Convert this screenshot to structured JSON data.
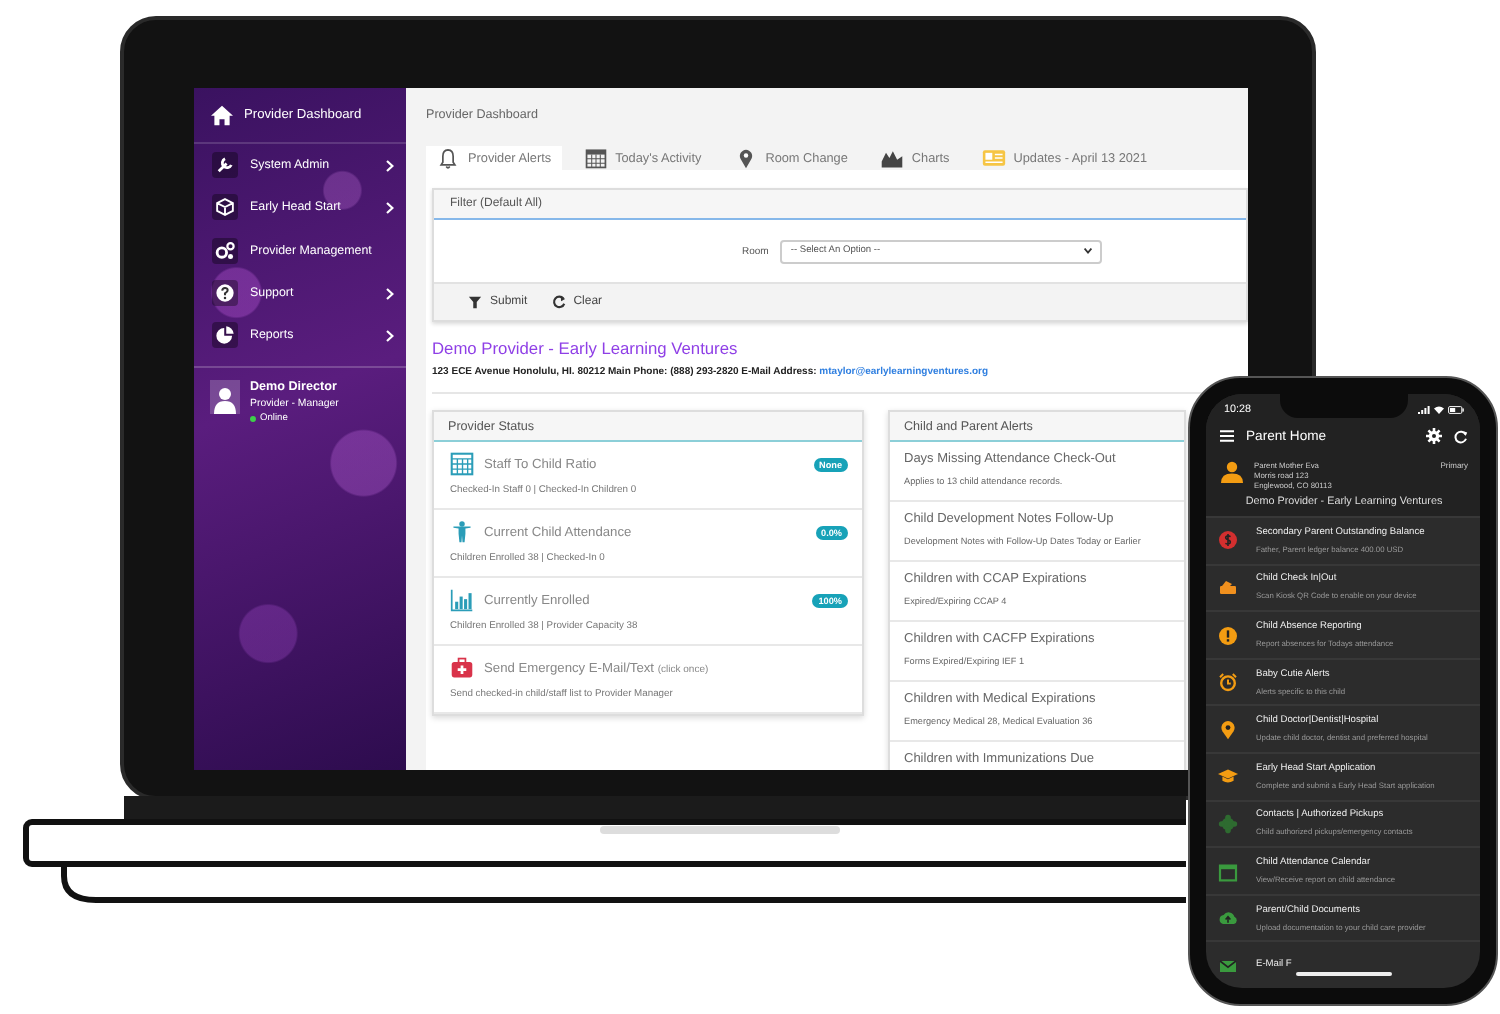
{
  "laptop": {
    "sidebar": {
      "header": "Provider Dashboard",
      "items": [
        {
          "label": "System Admin",
          "has_submenu": true
        },
        {
          "label": "Early Head Start",
          "has_submenu": true
        },
        {
          "label": "Provider Management",
          "has_submenu": false
        },
        {
          "label": "Support",
          "has_submenu": true
        },
        {
          "label": "Reports",
          "has_submenu": true
        }
      ],
      "user": {
        "name": "Demo Director",
        "role": "Provider - Manager",
        "status": "Online"
      }
    },
    "breadcrumb": "Provider Dashboard",
    "tabs": [
      {
        "label": "Provider Alerts",
        "selected": true
      },
      {
        "label": "Today's Activity",
        "selected": false
      },
      {
        "label": "Room Change",
        "selected": false
      },
      {
        "label": "Charts",
        "selected": false
      },
      {
        "label": "Updates - April 13 2021",
        "selected": false
      }
    ],
    "filter": {
      "title": "Filter (Default All)",
      "room_label": "Room",
      "room_value": "-- Select An Option --",
      "buttons": [
        "Submit",
        "Clear"
      ]
    },
    "provider": {
      "name": "Demo Provider - Early Learning Ventures",
      "address": "123 ECE Avenue  Honolulu, HI. 80212  Main Phone: (888) 293-2820  E-Mail Address:",
      "email": "mtaylor@earlylearningventures.org"
    },
    "provider_status": {
      "title": "Provider Status",
      "rows": [
        {
          "title": "Staff To Child Ratio",
          "badge": "None",
          "detail": "Checked-In Staff 0 | Checked-In Children 0"
        },
        {
          "title": "Current Child Attendance",
          "badge": "0.0%",
          "detail": "Children Enrolled 38 | Checked-In 0"
        },
        {
          "title": "Currently Enrolled",
          "badge": "100%",
          "detail": "Children Enrolled 38 | Provider Capacity 38"
        },
        {
          "title": "Send Emergency E-Mail/Text",
          "note": "(click once)",
          "detail": "Send checked-in child/staff list to Provider Manager"
        }
      ]
    },
    "alerts": {
      "title": "Child and Parent Alerts",
      "rows": [
        {
          "title": "Days Missing Attendance Check-Out",
          "detail": "Applies to 13 child attendance records."
        },
        {
          "title": "Child Development Notes Follow-Up",
          "detail": "Development Notes with Follow-Up Dates Today or Earlier"
        },
        {
          "title": "Children with CCAP Expirations",
          "detail": "Expired/Expiring CCAP 4"
        },
        {
          "title": "Children with CACFP Expirations",
          "detail": "Forms Expired/Expiring IEF 1"
        },
        {
          "title": "Children with Medical Expirations",
          "detail": "Emergency Medical 28, Medical Evaluation 36"
        },
        {
          "title": "Children with Immunizations Due"
        }
      ]
    }
  },
  "phone": {
    "time": "10:28",
    "title": "Parent Home",
    "profile": {
      "lines": [
        "Parent Mother Eva",
        "Morris road 123",
        "Englewood, CO 80113"
      ],
      "tag": "Primary",
      "provider": "Demo Provider - Early Learning Ventures"
    },
    "items": [
      {
        "title": "Secondary Parent Outstanding Balance",
        "detail": "Father, Parent ledger balance 400.00 USD",
        "color": "#d32f2f"
      },
      {
        "title": "Child Check In|Out",
        "detail": "Scan Kiosk QR Code to enable on your device",
        "color": "#f0901e"
      },
      {
        "title": "Child Absence Reporting",
        "detail": "Report absences for Todays attendance",
        "color": "#f39c12"
      },
      {
        "title": "Baby Cutie Alerts",
        "detail": "Alerts specific to this child",
        "color": "#f39c12"
      },
      {
        "title": "Child Doctor|Dentist|Hospital",
        "detail": "Update child doctor, dentist and preferred hospital",
        "color": "#f39c12"
      },
      {
        "title": "Early Head Start Application",
        "detail": "Complete and submit a Early Head Start application",
        "color": "#f39c12"
      },
      {
        "title": "Contacts | Authorized Pickups",
        "detail": "Child authorized pickups/emergency contacts",
        "color": "#2e6b30"
      },
      {
        "title": "Child Attendance Calendar",
        "detail": "View/Receive report on child attendance",
        "color": "#3a9a3e"
      },
      {
        "title": "Parent/Child Documents",
        "detail": "Upload documentation to your child care provider",
        "color": "#3a9a3e"
      },
      {
        "title": "E-Mail F",
        "color": "#3a9a3e"
      }
    ]
  }
}
